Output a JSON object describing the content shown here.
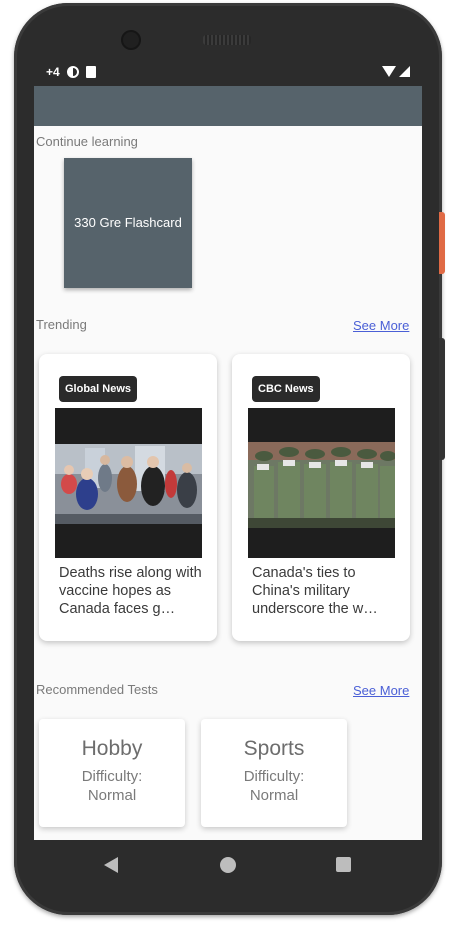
{
  "status_bar": {
    "time_fragment": "+4"
  },
  "continue_learning": {
    "label": "Continue learning",
    "flashcard_title": "330 Gre Flashcard"
  },
  "trending": {
    "label": "Trending",
    "see_more": "See More",
    "articles": [
      {
        "source": "Global News",
        "headline": "Deaths rise along with vaccine hopes as Canada faces g…"
      },
      {
        "source": "CBC News",
        "headline": "Canada's ties to China's military underscore the w…"
      }
    ]
  },
  "recommended_tests": {
    "label": "Recommended Tests",
    "see_more": "See More",
    "tests": [
      {
        "title": "Hobby",
        "difficulty_label": "Difficulty:",
        "difficulty": "Normal"
      },
      {
        "title": "Sports",
        "difficulty_label": "Difficulty:",
        "difficulty": "Normal"
      }
    ]
  },
  "colors": {
    "app_bar": "#56636b",
    "link": "#4a5fd6",
    "phone_frame": "#2c2c2c"
  },
  "icons": [
    "data-saver-icon",
    "sim-card-icon",
    "wifi-icon",
    "signal-icon",
    "back-icon",
    "home-icon",
    "recents-icon"
  ]
}
